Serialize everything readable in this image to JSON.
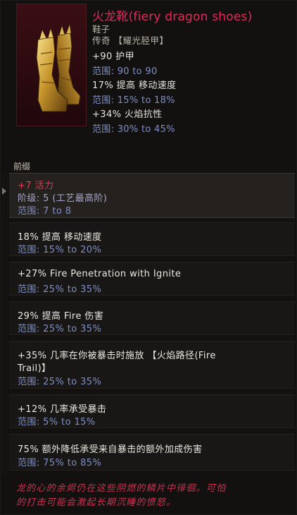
{
  "item": {
    "title": "火龙靴(fiery dragon shoes)",
    "type": "鞋子",
    "rarity": "传奇 【耀光胫甲】",
    "icon": "golden-boots-icon"
  },
  "base_stats": [
    {
      "label": "+90 护甲",
      "range": "范围: 90 to 90"
    },
    {
      "label": "17% 提高 移动速度",
      "range": "范围: 15% to 18%"
    },
    {
      "label": "+34% 火焰抗性",
      "range": "范围: 30% to 45%"
    }
  ],
  "affix_section_title": "前缀",
  "affixes": [
    {
      "line1": "+7 活力",
      "line2": "阶级: 5 (工艺最高阶)",
      "line3": "范围: 7 to 8"
    },
    {
      "line1": "18% 提高 移动速度",
      "range": "范围: 15% to 20%"
    },
    {
      "line1": "+27% Fire Penetration with Ignite",
      "range": "范围: 25% to 35%"
    },
    {
      "line1": "29% 提高 Fire 伤害",
      "range": "范围: 25% to 35%"
    },
    {
      "line1": "+35% 几率在你被暴击时施放 【火焰路径(Fire",
      "line2": "Trail)】",
      "range": "范围: 25% to 35%"
    },
    {
      "line1": "+12% 几率承受暴击",
      "range": "范围: 5% to 15%"
    },
    {
      "line1": "75% 额外降低承受来自暴击的额外加成伤害",
      "range": "范围: 75% to 85%"
    }
  ],
  "lore": {
    "line1": "龙的心的余烬仍在这些阴燃的鳞片中徘徊。可怕",
    "line2": "的打击可能会激起长期沉睡的愤怒。"
  },
  "colors": {
    "title": "#e3295b",
    "range": "#7f8fc3",
    "lore": "#cf2f50",
    "affix_highlight": "#e33b55"
  }
}
